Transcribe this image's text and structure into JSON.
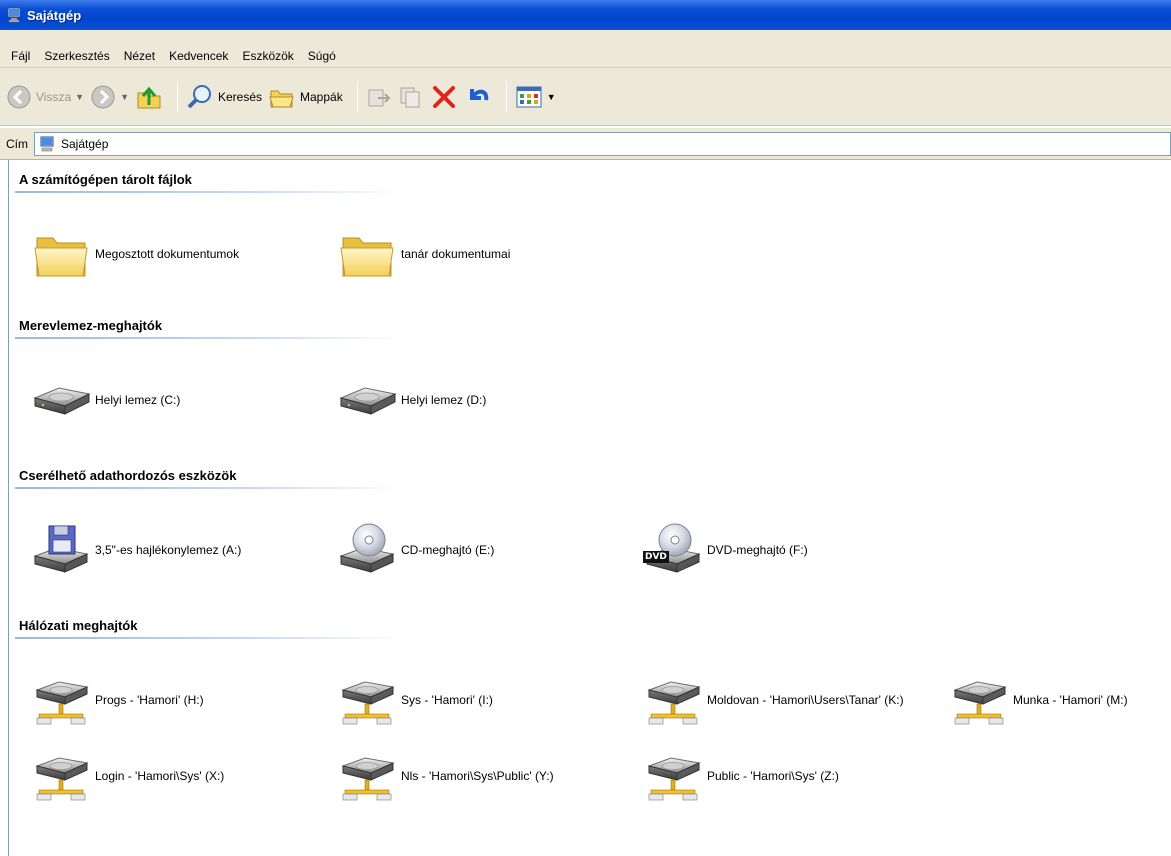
{
  "window": {
    "title": "Sajátgép"
  },
  "menu": [
    "Fájl",
    "Szerkesztés",
    "Nézet",
    "Kedvencek",
    "Eszközök",
    "Súgó"
  ],
  "toolbar": {
    "back_label": "Vissza",
    "search_label": "Keresés",
    "folders_label": "Mappák"
  },
  "address": {
    "label": "Cím",
    "value": "Sajátgép"
  },
  "groups": [
    {
      "title": "A számítógépen tárolt fájlok",
      "items": [
        {
          "name": "Megosztott dokumentumok",
          "icon": "folder-icon"
        },
        {
          "name": "tanár dokumentumai",
          "icon": "folder-icon"
        }
      ]
    },
    {
      "title": "Merevlemez-meghajtók",
      "items": [
        {
          "name": "Helyi lemez (C:)",
          "icon": "hard-disk-icon"
        },
        {
          "name": "Helyi lemez (D:)",
          "icon": "hard-disk-icon"
        }
      ]
    },
    {
      "title": "Cserélhető adathordozós eszközök",
      "items": [
        {
          "name": "3,5\"-es hajlékonylemez (A:)",
          "icon": "floppy-drive-icon"
        },
        {
          "name": "CD-meghajtó (E:)",
          "icon": "cd-drive-icon"
        },
        {
          "name": "DVD-meghajtó (F:)",
          "icon": "dvd-drive-icon",
          "badge": "DVD"
        }
      ]
    },
    {
      "title": "Hálózati meghajtók",
      "items": [
        {
          "name": "Progs - 'Hamori' (H:)",
          "icon": "network-drive-icon"
        },
        {
          "name": "Sys - 'Hamori' (I:)",
          "icon": "network-drive-icon"
        },
        {
          "name": "Moldovan - 'Hamori\\Users\\Tanar' (K:)",
          "icon": "network-drive-icon"
        },
        {
          "name": "Munka - 'Hamori' (M:)",
          "icon": "network-drive-icon"
        },
        {
          "name": "Login - 'Hamori\\Sys' (X:)",
          "icon": "network-drive-icon"
        },
        {
          "name": "Nls - 'Hamori\\Sys\\Public' (Y:)",
          "icon": "network-drive-icon"
        },
        {
          "name": "Public - 'Hamori\\Sys' (Z:)",
          "icon": "network-drive-icon"
        }
      ]
    }
  ],
  "colors": {
    "titlebar": "#0a4fd6",
    "chrome": "#ece9d8",
    "group_line": "#9cb7e0"
  }
}
